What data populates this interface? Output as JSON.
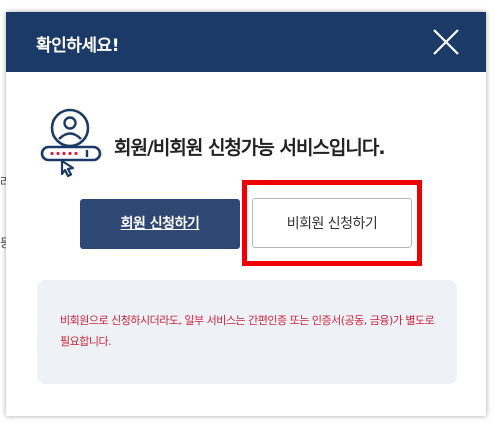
{
  "background": {
    "fragments": [
      "라",
      "등"
    ]
  },
  "modal": {
    "title": "확인하세요!",
    "close_icon": "close-icon",
    "intro_icon": "user-id-card-icon",
    "intro_text": "회원/비회원 신청가능 서비스입니다.",
    "member_button_label": "회원 신청하기",
    "guest_button_label": "비회원 신청하기",
    "notice_text": "비회원으로 신청하시더라도, 일부 서비스는 간편인증 또는 인증서(공동, 금융)가 별도로 필요합니다."
  },
  "colors": {
    "header_bg": "#1c3a67",
    "member_button_bg": "#2f4873",
    "highlight_border": "#ee0000",
    "notice_bg": "#eef2f7",
    "notice_text": "#d0233a",
    "icon_navy": "#1c3a67",
    "icon_accent": "#d0233a"
  }
}
